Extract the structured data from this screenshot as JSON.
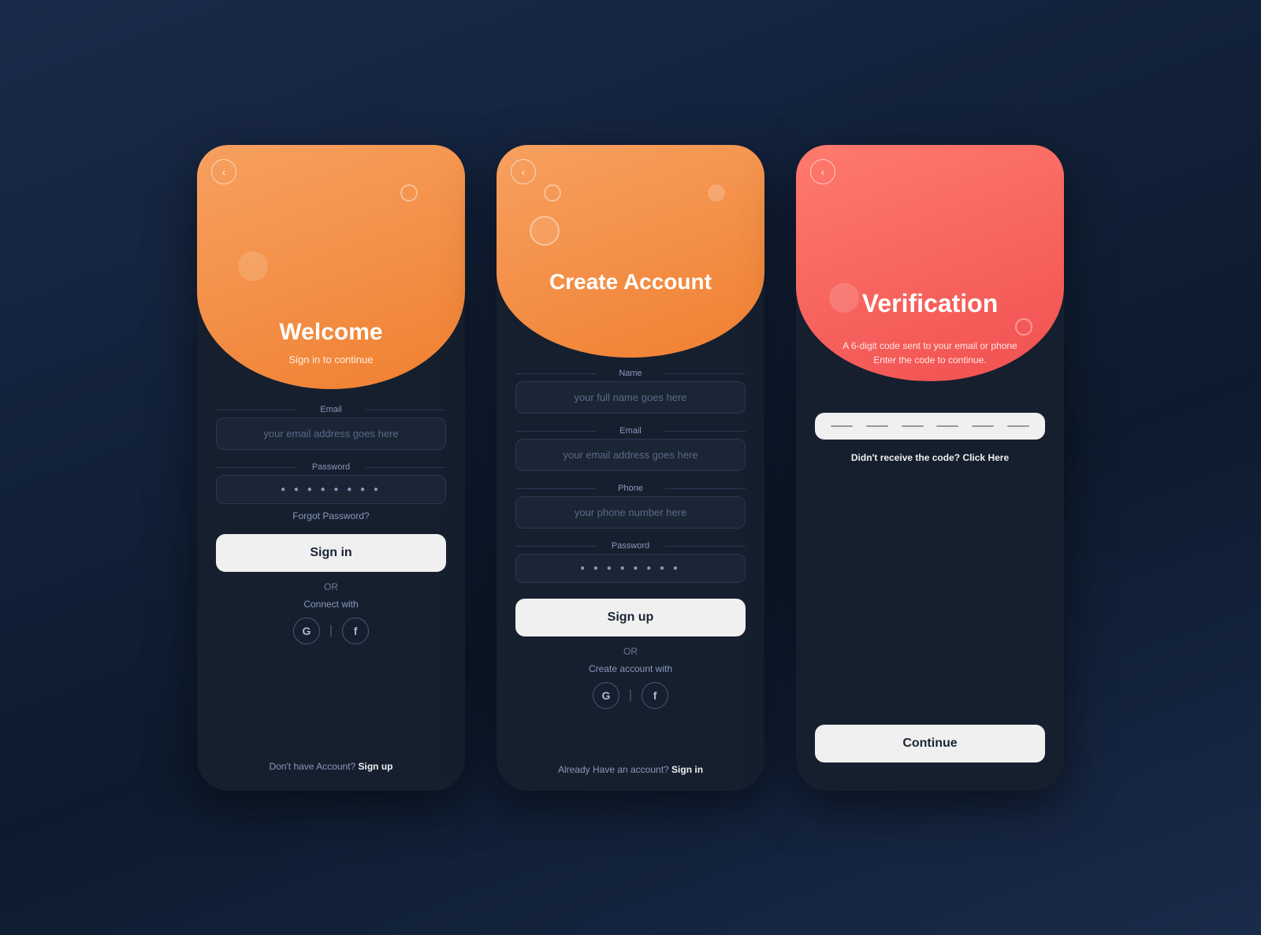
{
  "cards": {
    "welcome": {
      "title": "Welcome",
      "subtitle": "Sign in to continue",
      "back_label": "‹",
      "email_label": "Email",
      "email_placeholder": "your email address goes here",
      "password_label": "Password",
      "password_dots": "● ● ● ● ● ● ● ●",
      "forgot_password": "Forgot Password?",
      "signin_btn": "Sign in",
      "or_text": "OR",
      "connect_label": "Connect with",
      "google_icon": "G",
      "facebook_icon": "f",
      "bottom_text_normal": "Don't have Account? ",
      "bottom_text_bold": "Sign up"
    },
    "create": {
      "title": "Create Account",
      "back_label": "‹",
      "name_label": "Name",
      "name_placeholder": "your full name goes here",
      "email_label": "Email",
      "email_placeholder": "your email address goes here",
      "phone_label": "Phone",
      "phone_placeholder": "your phone number here",
      "password_label": "Password",
      "password_dots": "● ● ● ● ● ● ● ●",
      "signup_btn": "Sign up",
      "or_text": "OR",
      "create_with_label": "Create account with",
      "google_icon": "G",
      "facebook_icon": "f",
      "bottom_text_normal": "Already Have an account? ",
      "bottom_text_bold": "Sign in"
    },
    "verify": {
      "title": "Verification",
      "subtitle_line1": "A 6-digit code sent to your email or phone",
      "subtitle_line2": "Enter the code to continue.",
      "back_label": "‹",
      "resend_text_normal": "Didn't receive the code? ",
      "resend_text_link": "Click Here",
      "continue_btn": "Continue"
    }
  }
}
